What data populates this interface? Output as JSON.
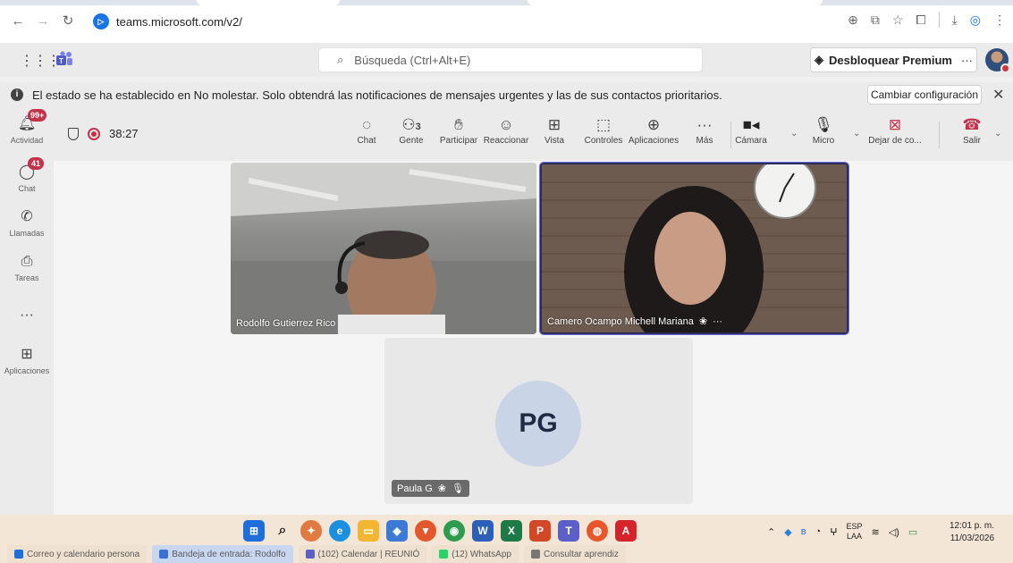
{
  "browser": {
    "url": "teams.microsoft.com/v2/",
    "site_icon_glyph": "▷"
  },
  "teams": {
    "search_placeholder": "Búsqueda (Ctrl+Alt+E)",
    "premium_label": "Desbloquear Premium",
    "premium_more": "···"
  },
  "notice": {
    "message": "El estado se ha establecido en No molestar. Solo obtendrá las notificaciones de mensajes urgentes y las de sus contactos prioritarios.",
    "change_button": "Cambiar configuración",
    "close": "✕"
  },
  "rail": {
    "items": [
      {
        "label": "Actividad",
        "badge": "99+",
        "icon": "bell-icon"
      },
      {
        "label": "Chat",
        "badge": "41",
        "icon": "chat-icon"
      },
      {
        "label": "Llamadas",
        "badge": "",
        "icon": "phone-icon"
      },
      {
        "label": "Tareas",
        "badge": "",
        "icon": "tasks-icon"
      },
      {
        "label": "",
        "badge": "",
        "icon": "more-icon"
      },
      {
        "label": "Aplicaciones",
        "badge": "",
        "icon": "apps-icon"
      }
    ]
  },
  "meeting": {
    "timer": "38:27",
    "tools": {
      "chat": "Chat",
      "people": "Gente",
      "people_count": "3",
      "raise": "Participar",
      "react": "Reaccionar",
      "view": "Vista",
      "controls": "Controles",
      "apps": "Aplicaciones",
      "more": "Más",
      "camera": "Cámara",
      "mic": "Micro",
      "stop_share": "Dejar de co...",
      "leave": "Salir"
    }
  },
  "participants": [
    {
      "name": "Rodolfo Gutierrez Rico"
    },
    {
      "name": "Camero Ocampo Michell Mariana",
      "more": "···"
    },
    {
      "name": "Paula G",
      "initials": "PG"
    }
  ],
  "taskbar": {
    "lang_top": "ESP",
    "lang_bottom": "LAA",
    "time": "12:01 p. m.",
    "date": "11/03/2026",
    "tasks": [
      "Correo y calendario persona",
      "Bandeja de entrada: Rodolfo",
      "(102) Calendar | REUNIÓ",
      "(12) WhatsApp",
      "Consultar aprendiz"
    ]
  },
  "colors": {
    "accent": "#6264a7",
    "badge": "#c4314b",
    "leave_red": "#c4314b",
    "taskbar_bg": "#f3e6d6"
  }
}
